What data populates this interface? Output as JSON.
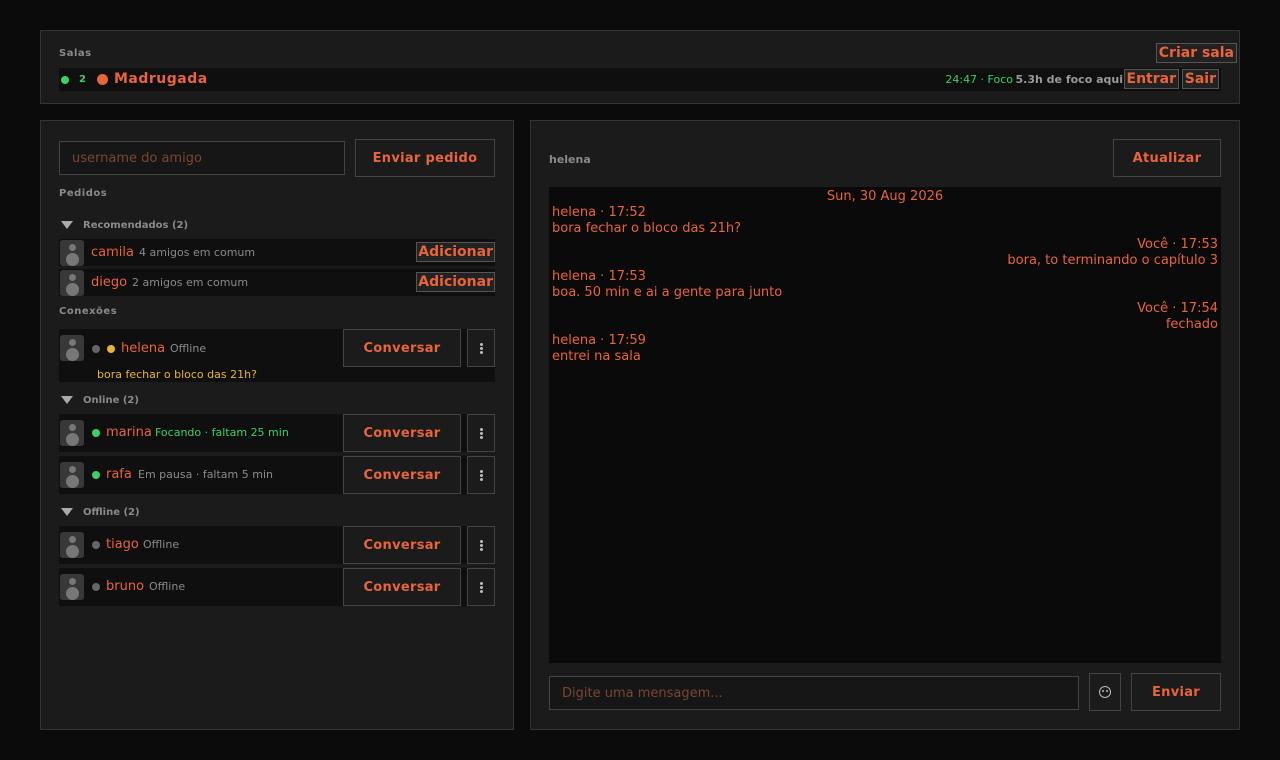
{
  "rooms": {
    "label": "Salas",
    "create_label": "Criar sala",
    "room": {
      "online_count": "2",
      "name": "Madrugada",
      "timer": "24:47 · Foco",
      "focus_hours": "5.3h de foco aqui",
      "enter_label": "Entrar",
      "leave_label": "Sair"
    }
  },
  "friends": {
    "input_placeholder": "username do amigo",
    "send_request_label": "Enviar pedido",
    "requests_title": "Pedidos",
    "recommended_title": "Recomendados (2)",
    "recommended": [
      {
        "name": "camila",
        "meta": "4 amigos em comum",
        "action": "Adicionar"
      },
      {
        "name": "diego",
        "meta": "2 amigos em comum",
        "action": "Adicionar"
      }
    ],
    "connections_title": "Conexões",
    "connection": {
      "name": "helena",
      "status": "Offline",
      "preview": "bora fechar o bloco das 21h?",
      "chat_label": "Conversar"
    },
    "online_title": "Online (2)",
    "online": [
      {
        "name": "marina",
        "status": "Focando · faltam 25 min",
        "chat_label": "Conversar"
      },
      {
        "name": "rafa",
        "status": "Em pausa · faltam 5 min",
        "chat_label": "Conversar"
      }
    ],
    "offline_title": "Offline (2)",
    "offline": [
      {
        "name": "tiago",
        "status": "Offline",
        "chat_label": "Conversar"
      },
      {
        "name": "bruno",
        "status": "Offline",
        "chat_label": "Conversar"
      }
    ]
  },
  "chat": {
    "user": "helena",
    "refresh_label": "Atualizar",
    "date": "Sun, 30 Aug 2026",
    "messages": [
      {
        "header": "helena · 17:52",
        "text": "bora fechar o bloco das 21h?"
      },
      {
        "header": "Você · 17:53",
        "text": "bora, to terminando o capítulo 3"
      },
      {
        "header": "helena · 17:53",
        "text": "boa. 50 min e ai a gente para junto"
      },
      {
        "header": "Você · 17:54",
        "text": "fechado"
      },
      {
        "header": "helena · 17:59",
        "text": "entrei na sala"
      }
    ],
    "input_placeholder": "Digite uma mensagem...",
    "send_label": "Enviar"
  },
  "colors": {
    "accent": "#e8643a",
    "online": "#3ecf6a",
    "away": "#e8b431",
    "background": "#0b0b0b",
    "panel": "#1b1b1b"
  }
}
